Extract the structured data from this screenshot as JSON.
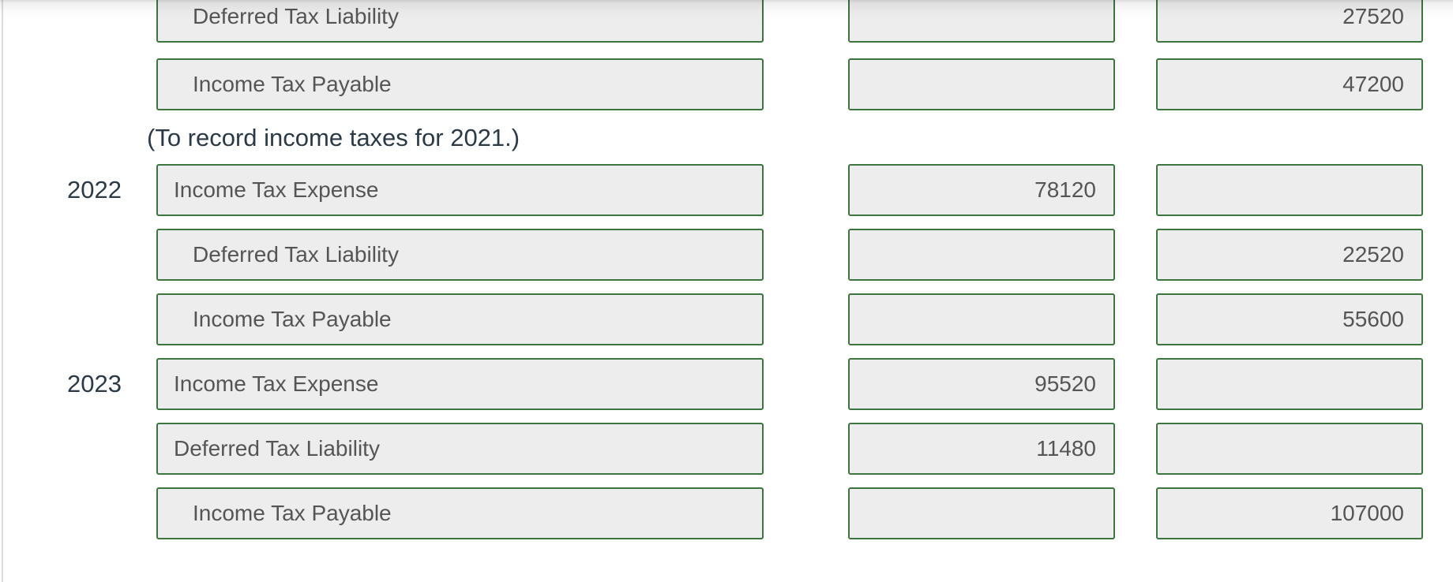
{
  "journal": {
    "rows": [
      {
        "year": "",
        "account": "Deferred Tax Liability",
        "indent": 1,
        "debit": "",
        "credit": "27520"
      },
      {
        "year": "",
        "account": "Income Tax Payable",
        "indent": 1,
        "debit": "",
        "credit": "47200"
      },
      {
        "year": "2022",
        "account": "Income Tax Expense",
        "indent": 0,
        "debit": "78120",
        "credit": ""
      },
      {
        "year": "",
        "account": "Deferred Tax Liability",
        "indent": 1,
        "debit": "",
        "credit": "22520"
      },
      {
        "year": "",
        "account": "Income Tax Payable",
        "indent": 1,
        "debit": "",
        "credit": "55600"
      },
      {
        "year": "2023",
        "account": "Income Tax Expense",
        "indent": 0,
        "debit": "95520",
        "credit": ""
      },
      {
        "year": "",
        "account": "Deferred Tax Liability",
        "indent": 0,
        "debit": "11480",
        "credit": ""
      },
      {
        "year": "",
        "account": "Income Tax Payable",
        "indent": 1,
        "debit": "",
        "credit": "107000"
      }
    ],
    "note_2021": "(To record income taxes for 2021.)"
  },
  "colors": {
    "field_border": "#3e7440",
    "field_background": "#ededed",
    "label_text": "#2b3a47",
    "field_text": "#555555"
  }
}
